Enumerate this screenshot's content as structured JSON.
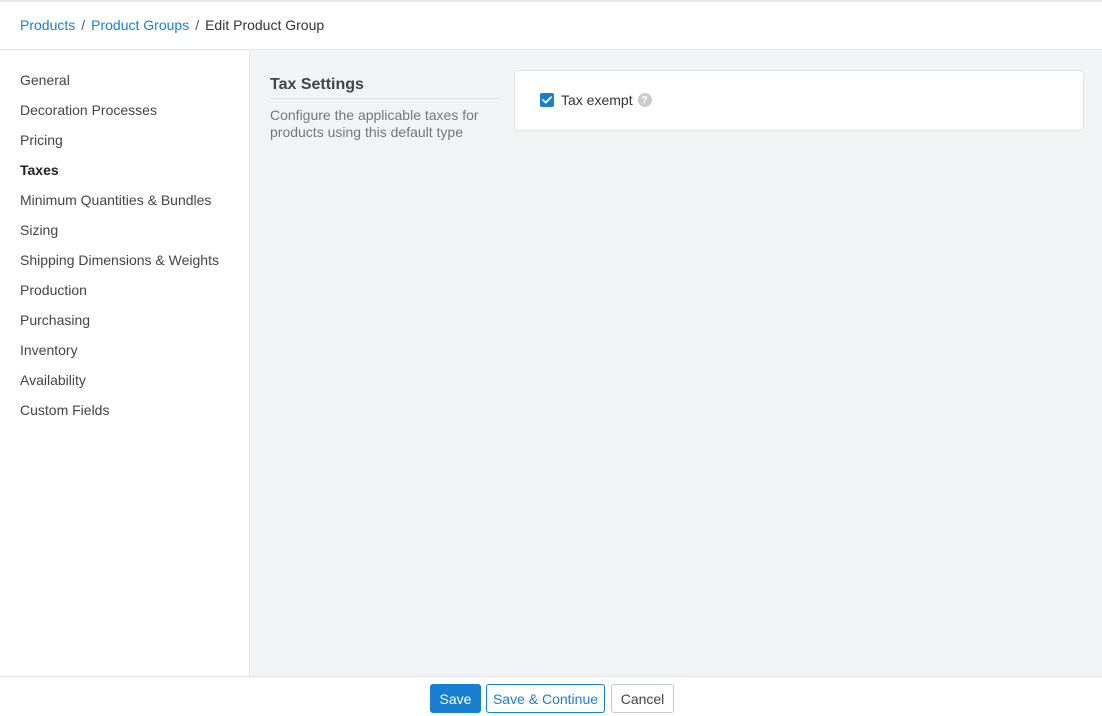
{
  "breadcrumb": {
    "items": [
      {
        "label": "Products"
      },
      {
        "label": "Product Groups"
      },
      {
        "label": "Edit Product Group"
      }
    ],
    "separator": "/"
  },
  "sidebar": {
    "items": [
      {
        "label": "General"
      },
      {
        "label": "Decoration Processes"
      },
      {
        "label": "Pricing"
      },
      {
        "label": "Taxes",
        "active": true
      },
      {
        "label": "Minimum Quantities & Bundles"
      },
      {
        "label": "Sizing"
      },
      {
        "label": "Shipping Dimensions & Weights"
      },
      {
        "label": "Production"
      },
      {
        "label": "Purchasing"
      },
      {
        "label": "Inventory"
      },
      {
        "label": "Availability"
      },
      {
        "label": "Custom Fields"
      }
    ]
  },
  "section": {
    "title": "Tax Settings",
    "description": "Configure the applicable taxes for products using this default type"
  },
  "tax_exempt": {
    "label": "Tax exempt",
    "checked": true,
    "help_icon": "question-circle-icon"
  },
  "footer": {
    "save_label": "Save",
    "save_continue_label": "Save & Continue",
    "cancel_label": "Cancel"
  },
  "colors": {
    "accent": "#1a7fd0",
    "background": "#f2f3f5"
  }
}
